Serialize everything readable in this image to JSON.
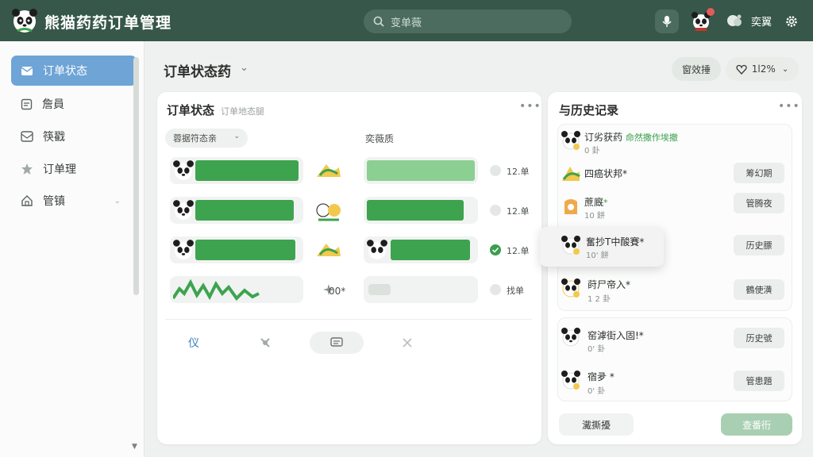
{
  "header": {
    "title": "熊猫药药订单管理",
    "search_placeholder": "变单薇",
    "user_label": "奕翼",
    "colors": {
      "bar": "#36574a",
      "accent": "#3a9e4d",
      "active_nav": "#6fa4d6"
    }
  },
  "sidebar": {
    "items": [
      {
        "label": "订单状态",
        "icon": "mail-icon",
        "active": true
      },
      {
        "label": "詹員",
        "icon": "note-icon"
      },
      {
        "label": "筷戳",
        "icon": "inbox-icon"
      },
      {
        "label": "订单理",
        "icon": "star-icon"
      },
      {
        "label": "管镇",
        "icon": "home-icon",
        "has_chevron": true
      }
    ]
  },
  "toolbar": {
    "page_title": "订单状态药",
    "action_label": "窗效捶",
    "zoom_label": "1l2%"
  },
  "order_panel": {
    "title": "订单状态",
    "subtitle": "订单地态腿",
    "filter_label": "蓉据符态亲",
    "column_header": "奕薇质",
    "rows": [
      {
        "qty": "12.单",
        "checked": false
      },
      {
        "qty": "12.单",
        "checked": false
      },
      {
        "qty": "12.单",
        "checked": true
      },
      {
        "qty": "找单",
        "checked": false
      }
    ],
    "row4_value": "00*",
    "footer_first_label": "仪"
  },
  "history_panel": {
    "title": "与历史记录",
    "items": [
      {
        "title": "订劣获药",
        "title_green": "命然撒作埃撤",
        "sub": "0 卦"
      },
      {
        "title": "四癌状邦*",
        "sub": "",
        "button": "筹幻期"
      },
      {
        "title": "蔗廐",
        "title_mark": "*",
        "sub": "10 餅",
        "button": "管腾夜"
      },
      {
        "title": "奮抄T中酸賽*",
        "sub": "10' 餅",
        "button": "历史膘"
      },
      {
        "title": "莳尸帝入*",
        "sub": "1 2 卦",
        "button": "鶴使潢"
      },
      {
        "title": "窑滹街入固!*",
        "sub": "0' 卦",
        "button": "历史號"
      },
      {
        "title": "宿夛 *",
        "sub": "0' 卦",
        "button": "管患題"
      }
    ],
    "footer_left": "瀻撕擾",
    "footer_right": "查番衎"
  }
}
